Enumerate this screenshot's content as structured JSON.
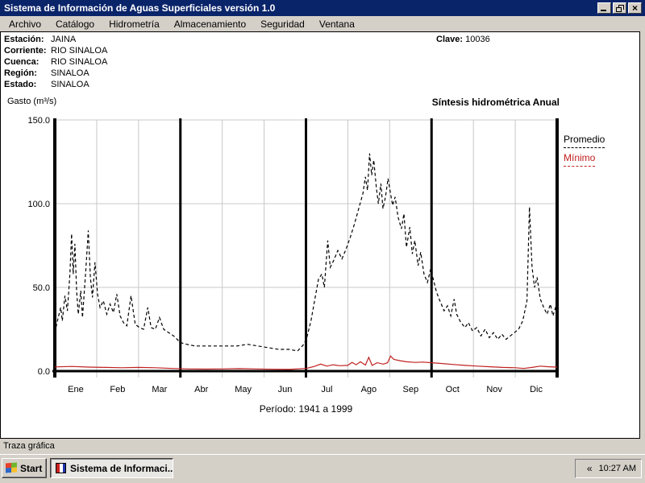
{
  "window": {
    "title": "Sistema de Información de Aguas Superficiales  versión 1.0",
    "close_glyph": "×"
  },
  "menu": {
    "items": [
      "Archivo",
      "Catálogo",
      "Hidrometría",
      "Almacenamiento",
      "Seguridad",
      "Ventana"
    ]
  },
  "station": {
    "rows": [
      {
        "label": "Estación:",
        "value": "JAINA"
      },
      {
        "label": "Corriente:",
        "value": "RIO SINALOA"
      },
      {
        "label": "Cuenca:",
        "value": "RIO SINALOA"
      },
      {
        "label": "Región:",
        "value": "SINALOA"
      },
      {
        "label": "Estado:",
        "value": "SINALOA"
      }
    ],
    "clave_label": "Clave:",
    "clave_value": "10036"
  },
  "chart_header": {
    "ylabel": "Gasto (m³/s)",
    "title": "Síntesis hidrométrica  Anual"
  },
  "chart_data": {
    "type": "line",
    "title": "Síntesis hidrométrica Anual",
    "ylabel": "Gasto (m³/s)",
    "ylim": [
      0,
      150
    ],
    "yticks": [
      0,
      50,
      100,
      150
    ],
    "ytick_labels": [
      "0.0",
      "50.0",
      "100.0",
      "150.0"
    ],
    "categories": [
      "Ene",
      "Feb",
      "Mar",
      "Abr",
      "May",
      "Jun",
      "Jul",
      "Ago",
      "Sep",
      "Oct",
      "Nov",
      "Dic"
    ],
    "quarter_line_months": [
      0,
      3,
      6,
      9,
      12
    ],
    "light_line_months": [
      1,
      2,
      4,
      5,
      7,
      8,
      10,
      11
    ],
    "grid": true,
    "legend_position": "right",
    "legend": [
      {
        "name": "Promedio",
        "color": "#000000",
        "style": "dashed"
      },
      {
        "name": "Mínimo",
        "color": "#c02020",
        "style": "solid"
      }
    ],
    "period_note": "Período: 1941 a 1999",
    "series": [
      {
        "name": "Promedio",
        "points": [
          [
            0.0,
            23
          ],
          [
            0.08,
            32
          ],
          [
            0.14,
            38
          ],
          [
            0.18,
            30
          ],
          [
            0.24,
            45
          ],
          [
            0.3,
            36
          ],
          [
            0.36,
            58
          ],
          [
            0.4,
            82
          ],
          [
            0.44,
            58
          ],
          [
            0.48,
            76
          ],
          [
            0.52,
            48
          ],
          [
            0.56,
            34
          ],
          [
            0.62,
            48
          ],
          [
            0.66,
            32
          ],
          [
            0.74,
            60
          ],
          [
            0.8,
            84
          ],
          [
            0.85,
            56
          ],
          [
            0.9,
            44
          ],
          [
            0.96,
            65
          ],
          [
            1.02,
            46
          ],
          [
            1.08,
            38
          ],
          [
            1.16,
            42
          ],
          [
            1.24,
            34
          ],
          [
            1.32,
            40
          ],
          [
            1.4,
            35
          ],
          [
            1.48,
            46
          ],
          [
            1.56,
            33
          ],
          [
            1.64,
            29
          ],
          [
            1.72,
            27
          ],
          [
            1.82,
            45
          ],
          [
            1.92,
            28
          ],
          [
            2.02,
            26
          ],
          [
            2.12,
            25
          ],
          [
            2.22,
            38
          ],
          [
            2.3,
            26
          ],
          [
            2.4,
            25
          ],
          [
            2.5,
            32
          ],
          [
            2.6,
            25
          ],
          [
            2.72,
            23
          ],
          [
            2.84,
            21
          ],
          [
            3.0,
            17
          ],
          [
            3.15,
            16
          ],
          [
            3.35,
            15
          ],
          [
            3.6,
            15
          ],
          [
            3.85,
            15
          ],
          [
            4.1,
            15
          ],
          [
            4.35,
            15
          ],
          [
            4.6,
            16
          ],
          [
            4.85,
            15
          ],
          [
            5.1,
            14
          ],
          [
            5.35,
            13
          ],
          [
            5.6,
            13
          ],
          [
            5.8,
            12
          ],
          [
            5.95,
            16
          ],
          [
            6.02,
            20
          ],
          [
            6.12,
            30
          ],
          [
            6.22,
            44
          ],
          [
            6.3,
            55
          ],
          [
            6.38,
            58
          ],
          [
            6.44,
            50
          ],
          [
            6.52,
            78
          ],
          [
            6.58,
            62
          ],
          [
            6.66,
            66
          ],
          [
            6.76,
            72
          ],
          [
            6.86,
            67
          ],
          [
            6.96,
            73
          ],
          [
            7.06,
            80
          ],
          [
            7.16,
            88
          ],
          [
            7.26,
            97
          ],
          [
            7.36,
            106
          ],
          [
            7.42,
            116
          ],
          [
            7.47,
            108
          ],
          [
            7.52,
            130
          ],
          [
            7.57,
            117
          ],
          [
            7.62,
            126
          ],
          [
            7.68,
            110
          ],
          [
            7.73,
            100
          ],
          [
            7.79,
            112
          ],
          [
            7.84,
            97
          ],
          [
            7.9,
            104
          ],
          [
            7.96,
            115
          ],
          [
            8.02,
            106
          ],
          [
            8.07,
            99
          ],
          [
            8.13,
            104
          ],
          [
            8.2,
            92
          ],
          [
            8.28,
            85
          ],
          [
            8.34,
            94
          ],
          [
            8.4,
            74
          ],
          [
            8.48,
            86
          ],
          [
            8.54,
            70
          ],
          [
            8.6,
            78
          ],
          [
            8.68,
            63
          ],
          [
            8.74,
            71
          ],
          [
            8.82,
            58
          ],
          [
            8.9,
            53
          ],
          [
            8.98,
            61
          ],
          [
            9.04,
            55
          ],
          [
            9.12,
            47
          ],
          [
            9.2,
            42
          ],
          [
            9.3,
            36
          ],
          [
            9.38,
            39
          ],
          [
            9.46,
            33
          ],
          [
            9.54,
            43
          ],
          [
            9.6,
            34
          ],
          [
            9.7,
            29
          ],
          [
            9.8,
            26
          ],
          [
            9.88,
            29
          ],
          [
            9.98,
            24
          ],
          [
            10.08,
            26
          ],
          [
            10.18,
            21
          ],
          [
            10.28,
            25
          ],
          [
            10.38,
            20
          ],
          [
            10.48,
            23
          ],
          [
            10.58,
            19
          ],
          [
            10.68,
            22
          ],
          [
            10.78,
            19
          ],
          [
            10.88,
            21
          ],
          [
            10.98,
            23
          ],
          [
            11.08,
            25
          ],
          [
            11.18,
            30
          ],
          [
            11.28,
            42
          ],
          [
            11.34,
            98
          ],
          [
            11.4,
            62
          ],
          [
            11.46,
            50
          ],
          [
            11.52,
            56
          ],
          [
            11.6,
            43
          ],
          [
            11.68,
            38
          ],
          [
            11.76,
            34
          ],
          [
            11.84,
            40
          ],
          [
            11.9,
            33
          ],
          [
            12.0,
            41
          ]
        ]
      },
      {
        "name": "Mínimo",
        "points": [
          [
            0.0,
            2.5
          ],
          [
            0.4,
            2.8
          ],
          [
            0.8,
            2.4
          ],
          [
            1.2,
            2.2
          ],
          [
            1.6,
            2.0
          ],
          [
            2.0,
            2.2
          ],
          [
            2.4,
            2.0
          ],
          [
            2.8,
            1.6
          ],
          [
            3.2,
            1.3
          ],
          [
            3.6,
            1.2
          ],
          [
            4.0,
            1.3
          ],
          [
            4.4,
            1.5
          ],
          [
            4.8,
            1.3
          ],
          [
            5.2,
            1.1
          ],
          [
            5.6,
            1.0
          ],
          [
            6.0,
            1.6
          ],
          [
            6.2,
            2.8
          ],
          [
            6.35,
            4.2
          ],
          [
            6.5,
            3.0
          ],
          [
            6.65,
            3.8
          ],
          [
            6.8,
            3.2
          ],
          [
            7.0,
            3.4
          ],
          [
            7.1,
            5.2
          ],
          [
            7.2,
            3.8
          ],
          [
            7.3,
            5.6
          ],
          [
            7.42,
            3.6
          ],
          [
            7.5,
            8.2
          ],
          [
            7.58,
            3.4
          ],
          [
            7.7,
            5.0
          ],
          [
            7.85,
            4.2
          ],
          [
            7.95,
            5.0
          ],
          [
            8.02,
            9.0
          ],
          [
            8.1,
            7.0
          ],
          [
            8.25,
            6.2
          ],
          [
            8.4,
            5.6
          ],
          [
            8.6,
            5.2
          ],
          [
            8.8,
            5.4
          ],
          [
            9.0,
            5.0
          ],
          [
            9.2,
            4.6
          ],
          [
            9.5,
            4.0
          ],
          [
            9.8,
            3.4
          ],
          [
            10.1,
            3.0
          ],
          [
            10.4,
            2.6
          ],
          [
            10.7,
            2.2
          ],
          [
            11.0,
            2.0
          ],
          [
            11.2,
            1.6
          ],
          [
            11.4,
            2.2
          ],
          [
            11.6,
            3.0
          ],
          [
            11.8,
            2.6
          ],
          [
            12.0,
            2.4
          ]
        ]
      }
    ]
  },
  "footer": {
    "periodo": "Período: 1941 a 1999"
  },
  "statusbar": {
    "text": "Traza gráfica"
  },
  "taskbar": {
    "start_label": "Start",
    "task_label": "Sistema de Informaci...",
    "tray_chevron": "«",
    "clock": "10:27 AM"
  },
  "colors": {
    "titlebar": "#0a246a",
    "face": "#d4d0c8",
    "promedio": "#000000",
    "minimo": "#c02020",
    "gridline": "#c8c8c8"
  }
}
